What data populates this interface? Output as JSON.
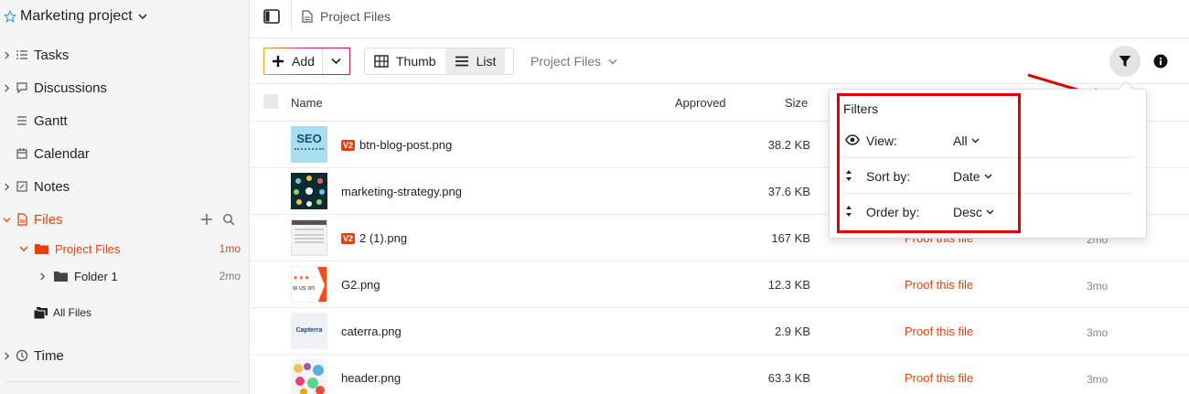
{
  "sidebar": {
    "project_title": "Marketing project",
    "nav": [
      {
        "label": "Tasks",
        "icon": "checklist-icon"
      },
      {
        "label": "Discussions",
        "icon": "speech-bubble-icon"
      },
      {
        "label": "Gantt",
        "icon": "gantt-icon"
      },
      {
        "label": "Calendar",
        "icon": "calendar-icon"
      },
      {
        "label": "Notes",
        "icon": "notes-icon"
      },
      {
        "label": "Files",
        "icon": "file-icon"
      },
      {
        "label": "Time",
        "icon": "clock-icon"
      }
    ],
    "tree": [
      {
        "label": "Project Files",
        "time": "1mo"
      },
      {
        "label": "Folder 1",
        "time": "2mo"
      },
      {
        "label": "All Files",
        "time": ""
      }
    ]
  },
  "topbar": {
    "breadcrumb": "Project Files"
  },
  "toolbar": {
    "add_label": "Add",
    "thumb_label": "Thumb",
    "list_label": "List",
    "folder_select": "Project Files"
  },
  "table": {
    "headers": {
      "name": "Name",
      "approved": "Approved",
      "size": "Size"
    },
    "rows": [
      {
        "name": "btn-blog-post.png",
        "badge": "V2",
        "size": "38.2 KB",
        "proof": "",
        "time": ""
      },
      {
        "name": "marketing-strategy.png",
        "badge": "",
        "size": "37.6 KB",
        "proof": "",
        "time": ""
      },
      {
        "name": "2 (1).png",
        "badge": "V2",
        "size": "167 KB",
        "proof": "Proof this file",
        "time": "2mo"
      },
      {
        "name": "G2.png",
        "badge": "",
        "size": "12.3 KB",
        "proof": "Proof this file",
        "time": "3mo"
      },
      {
        "name": "caterra.png",
        "badge": "",
        "size": "2.9 KB",
        "proof": "Proof this file",
        "time": "3mo"
      },
      {
        "name": "header.png",
        "badge": "",
        "size": "63.3 KB",
        "proof": "Proof this file",
        "time": "3mo"
      }
    ]
  },
  "filters": {
    "title": "Filters",
    "view": {
      "label": "View:",
      "value": "All"
    },
    "sort": {
      "label": "Sort by:",
      "value": "Date"
    },
    "order": {
      "label": "Order by:",
      "value": "Desc"
    }
  },
  "thumb_text": {
    "seo": "SEO",
    "capterra": "Capterra",
    "g2": "w us on"
  },
  "colors": {
    "accent": "#e8400c",
    "highlight": "#e00000",
    "sidebar_bg": "#f5f5f5"
  }
}
